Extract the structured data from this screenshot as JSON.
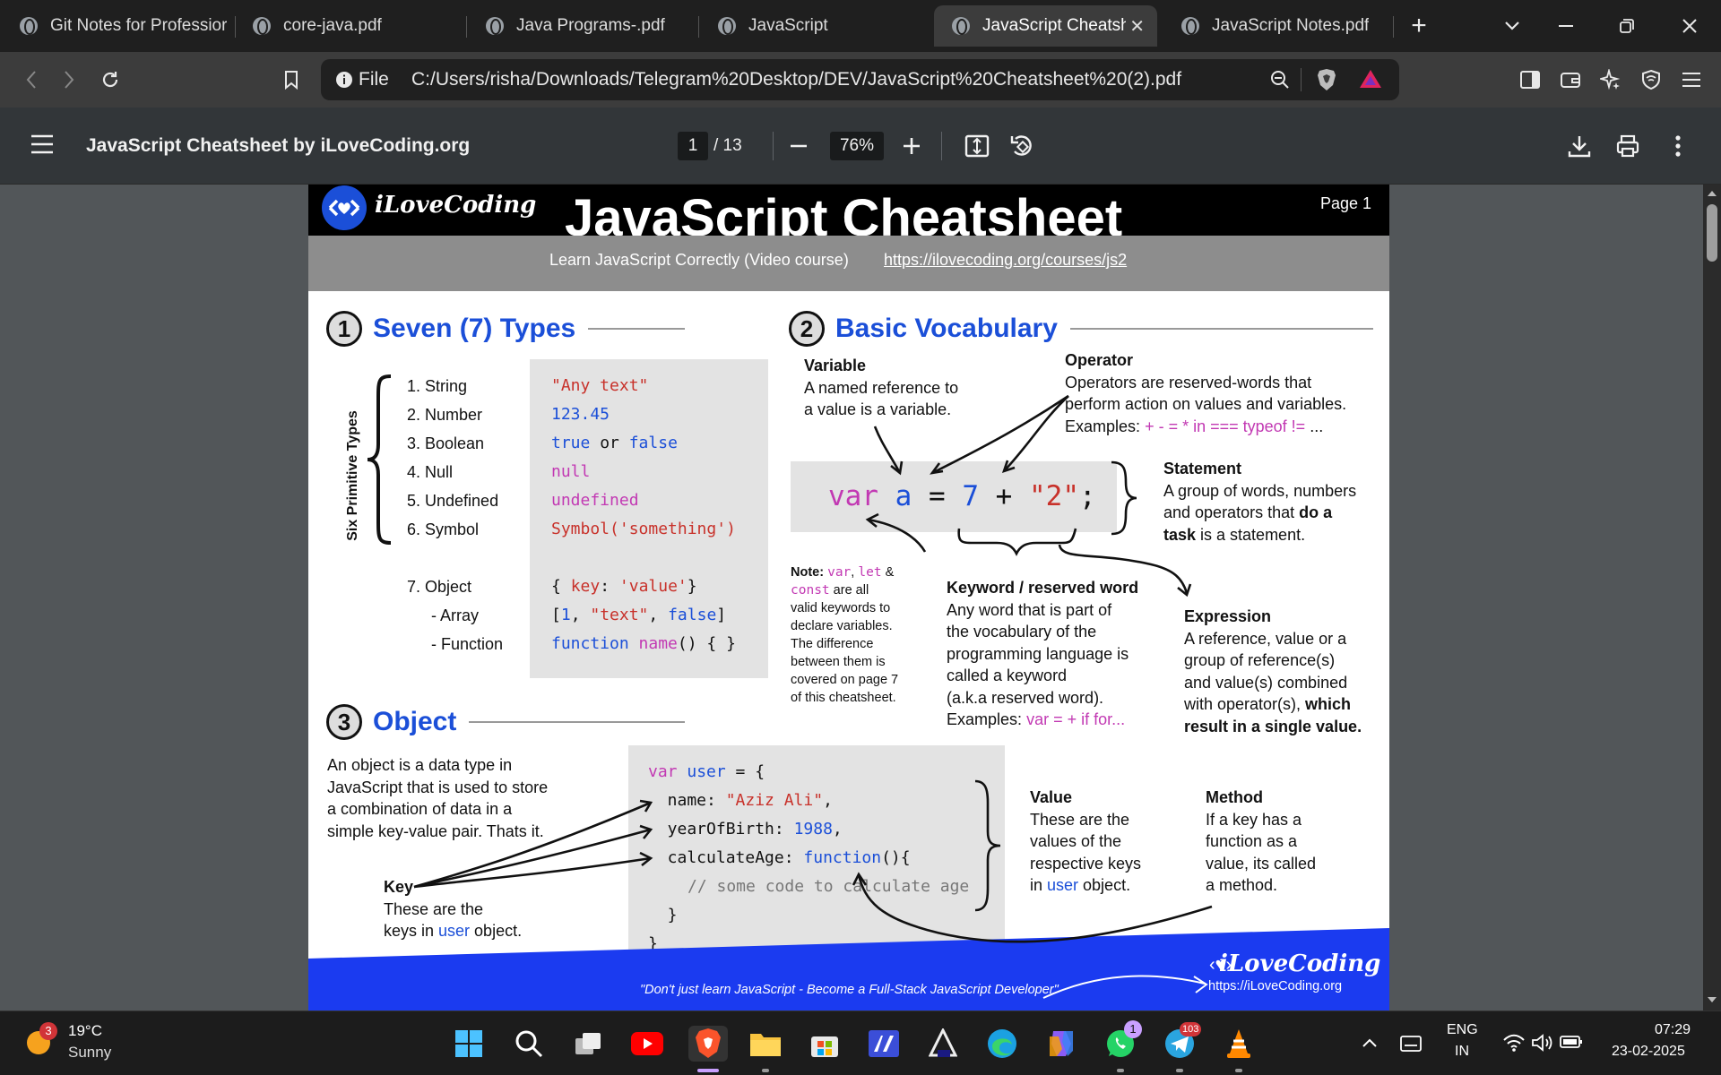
{
  "browser": {
    "tabs": [
      {
        "title": "Git Notes for Professior",
        "active": false
      },
      {
        "title": "core-java.pdf",
        "active": false
      },
      {
        "title": "Java Programs-.pdf",
        "active": false
      },
      {
        "title": "JavaScript",
        "active": false
      },
      {
        "title": "JavaScript Cheatsh",
        "active": true
      },
      {
        "title": "JavaScript Notes.pdf",
        "active": false
      }
    ],
    "new_tab": "+",
    "address": {
      "scheme_label": "File",
      "url": "C:/Users/risha/Downloads/Telegram%20Desktop/DEV/JavaScript%20Cheatsheet%20(2).pdf"
    }
  },
  "pdf_toolbar": {
    "title": "JavaScript Cheatsheet by iLoveCoding.org",
    "page_current": "1",
    "page_total": "/ 13",
    "zoom": "76%"
  },
  "doc": {
    "header": {
      "logo_text": "iLoveCoding",
      "title": "JavaScript Cheatsheet",
      "page_label": "Page 1",
      "subtitle": "Learn JavaScript Correctly (Video course)",
      "link": "https://ilovecoding.org/courses/js2"
    },
    "s1": {
      "num": "1",
      "title": "Seven (7) Types",
      "side_label": "Six Primitive Types",
      "types": [
        "1.  String",
        "2.  Number",
        "3.  Boolean",
        "4.  Null",
        "5.  Undefined",
        "6.  Symbol"
      ],
      "object": "7.  Object",
      "object_subs": [
        "- Array",
        "- Function"
      ]
    },
    "s2": {
      "num": "2",
      "title": "Basic Vocabulary",
      "variable_title": "Variable",
      "variable_lines": [
        "A named reference to",
        "a value is a variable."
      ],
      "operator_title": "Operator",
      "operator_lines": [
        "Operators are reserved-words that",
        "perform action on values and variables."
      ],
      "operator_examples_label": "Examples:",
      "operator_examples": "+ - = * in === typeof !=",
      "operator_examples_tail": " ...",
      "statement_title": "Statement",
      "statement_lines": [
        "A group of words, numbers",
        "and operators that "
      ],
      "statement_bold1": "do a",
      "statement_bold2": "task",
      "statement_tail": " is a statement.",
      "note_label": "Note:",
      "note_kw1": "var",
      "note_kw2": "let",
      "note_amp": " &",
      "note_kw3": "const",
      "note_text1": " are all",
      "note_lines": [
        "valid keywords to",
        "declare variables.",
        "The difference",
        "between them is",
        "covered on page 7",
        "of this cheatsheet."
      ],
      "keyword_title": "Keyword / reserved word",
      "keyword_lines": [
        "Any word that is part of",
        "the vocabulary of the",
        "programming language is",
        "called a keyword",
        "(a.k.a reserved word)."
      ],
      "keyword_examples_label": "Examples:",
      "keyword_examples": "var = + if for...",
      "expression_title": "Expression",
      "expression_lines": [
        "A reference, value or a",
        "group of reference(s)",
        "and value(s) combined",
        "with operator(s), "
      ],
      "expression_bold1": "which",
      "expression_bold2": "result in a single value."
    },
    "s3": {
      "num": "3",
      "title": "Object",
      "intro_lines": [
        "An object is a data type in",
        "JavaScript that is used to store",
        "a combination of data in a",
        "simple key-value pair. Thats it."
      ],
      "key_title": "Key",
      "key_lines": [
        "These are the",
        "keys in "
      ],
      "key_user": "user",
      "key_tail": " object.",
      "value_title": "Value",
      "value_lines": [
        "These are the",
        "values of the",
        "respective keys",
        "in "
      ],
      "value_user": "user",
      "value_tail": " object.",
      "method_title": "Method",
      "method_lines": [
        "If a key has a",
        "function as a",
        "value, its called",
        "a method."
      ],
      "code_comment": "// some code to calculate age"
    },
    "footer": {
      "quote": "\"Don't just learn JavaScript - Become a Full-Stack JavaScript Developer\"",
      "logo_text": "iLoveCoding",
      "url": "https://iLoveCoding.org"
    }
  },
  "taskbar": {
    "weather_temp": "19°C",
    "weather_desc": "Sunny",
    "weather_badge": "3",
    "whatsapp_badge": "1",
    "telegram_badge": "103",
    "lang1": "ENG",
    "lang2": "IN",
    "time": "07:29",
    "date": "23-02-2025"
  }
}
